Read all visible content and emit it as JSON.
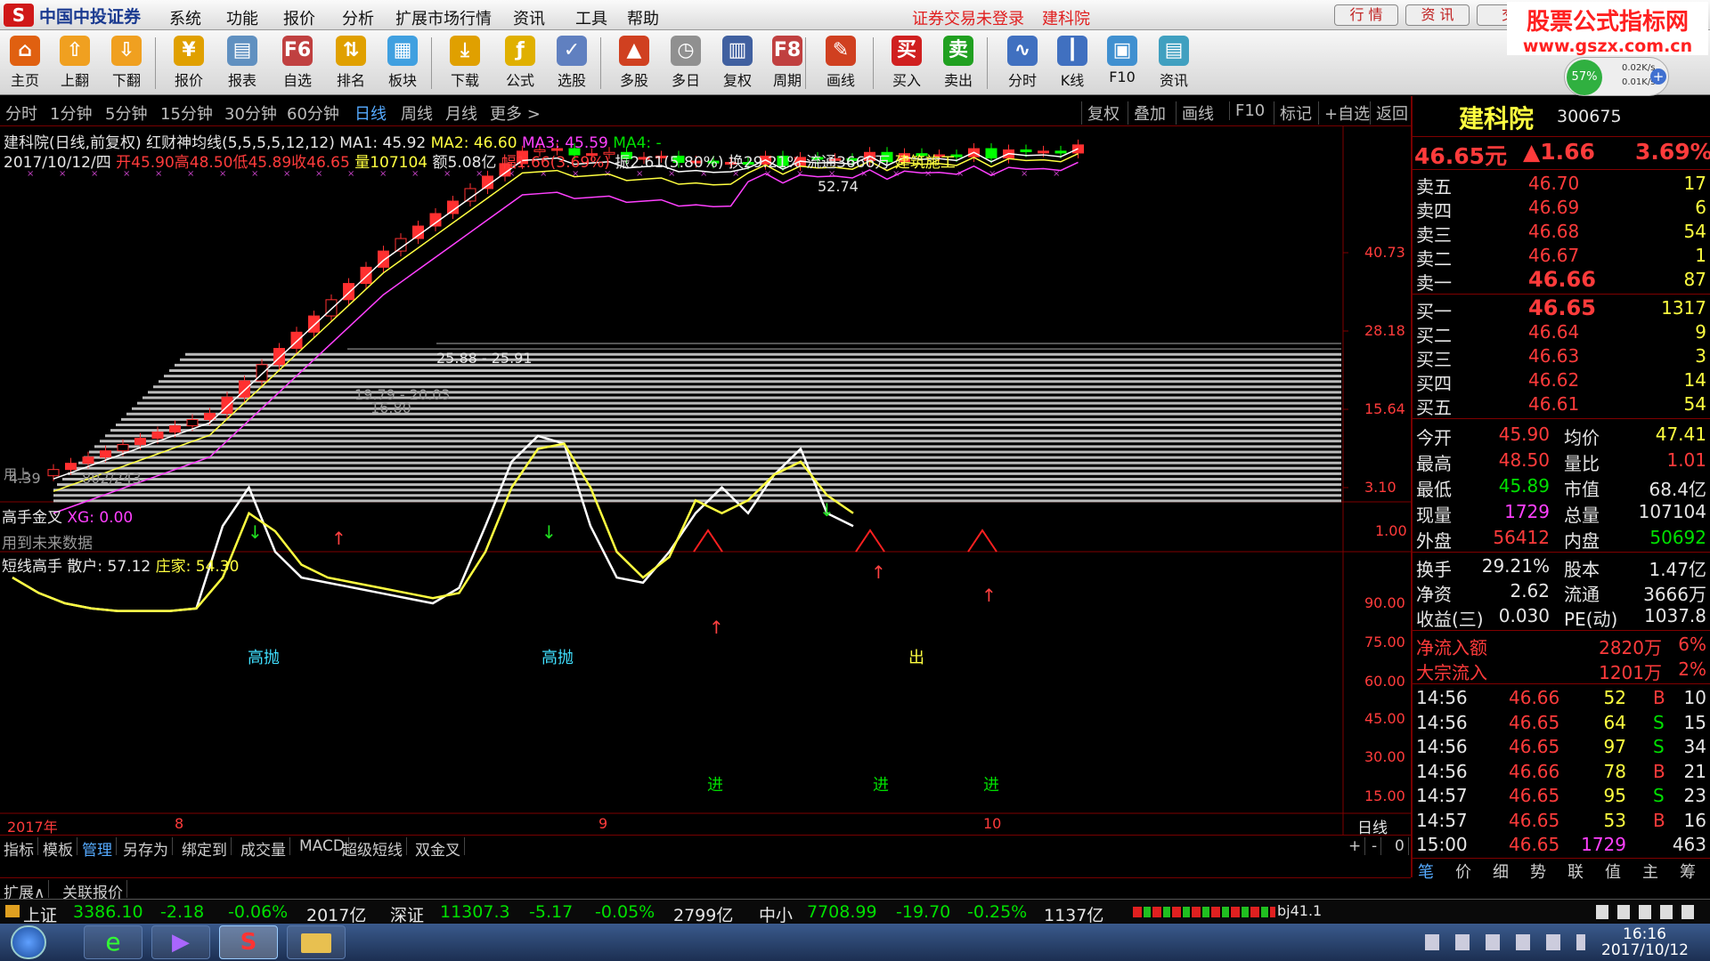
{
  "menu": {
    "app_name": "中国中投证券",
    "items": [
      "系统",
      "功能",
      "报价",
      "分析",
      "扩展市场行情",
      "资讯",
      "工具",
      "帮助"
    ],
    "status": "证券交易未登录",
    "stock": "建科院",
    "tabs": [
      "行 情",
      "资 讯",
      "交"
    ]
  },
  "watermark": {
    "title": "股票公式指标网",
    "url": "www.gszx.com.cn"
  },
  "net": {
    "pct": "57%",
    "up": "0.02K/s",
    "down": "0.01K/s"
  },
  "toolbar": [
    {
      "label": "主页",
      "icon": "home-icon",
      "color": "#e06010"
    },
    {
      "label": "上翻",
      "icon": "up-arrow-icon",
      "color": "#f0a020"
    },
    {
      "label": "下翻",
      "icon": "down-arrow-icon",
      "color": "#f0a020"
    },
    {
      "label": "报价",
      "icon": "yen-icon",
      "color": "#e0a000"
    },
    {
      "label": "报表",
      "icon": "report-icon",
      "color": "#6090c0"
    },
    {
      "label": "自选",
      "icon": "f6-icon",
      "color": "#c04040"
    },
    {
      "label": "排名",
      "icon": "rank-icon",
      "color": "#e0a000"
    },
    {
      "label": "板块",
      "icon": "blocks-icon",
      "color": "#40a0e0"
    },
    {
      "label": "下载",
      "icon": "download-icon",
      "color": "#e0a000"
    },
    {
      "label": "公式",
      "icon": "formula-icon",
      "color": "#e0b000"
    },
    {
      "label": "选股",
      "icon": "pick-stock-icon",
      "color": "#6080c0"
    },
    {
      "label": "多股",
      "icon": "multi-stock-icon",
      "color": "#d04020"
    },
    {
      "label": "多日",
      "icon": "clock-icon",
      "color": "#909090"
    },
    {
      "label": "复权",
      "icon": "restore-right-icon",
      "color": "#4060a0"
    },
    {
      "label": "周期",
      "icon": "f8-icon",
      "color": "#c04040"
    },
    {
      "label": "画线",
      "icon": "pencil-icon",
      "color": "#d04020"
    },
    {
      "label": "买入",
      "icon": "buy-icon",
      "color": "#d02020"
    },
    {
      "label": "卖出",
      "icon": "sell-icon",
      "color": "#20a020"
    },
    {
      "label": "分时",
      "icon": "intraday-icon",
      "color": "#4070c0"
    },
    {
      "label": "K线",
      "icon": "kline-icon",
      "color": "#4070c0"
    },
    {
      "label": "F10",
      "icon": "f10-icon",
      "color": "#4090d0"
    },
    {
      "label": "资讯",
      "icon": "news-icon",
      "color": "#40a0c0"
    }
  ],
  "periods": [
    "分时",
    "1分钟",
    "5分钟",
    "15分钟",
    "30分钟",
    "60分钟",
    "日线",
    "周线",
    "月线",
    "更多 >"
  ],
  "period_selected": "日线",
  "chart_tools": [
    "复权",
    "叠加",
    "画线",
    "F10",
    "标记",
    "+自选",
    "返回"
  ],
  "kline": {
    "info1_name": "建科院(日线,前复权) 红财神均线(5,5,5,5,12,12)",
    "ma1": "MA1: 45.92",
    "ma2": "MA2: 46.60",
    "ma3": "MA3: 45.59",
    "ma4": "MA4: -",
    "info2_date": "2017/10/12/四",
    "info2_open": "开45.90",
    "info2_high": "高48.50",
    "info2_low": "低45.89",
    "info2_close": "收46.65",
    "info2_vol": "量107104",
    "info2_amt": "额5.08亿",
    "info2_chg": "幅1.66(3.69%)",
    "info2_amp": "振2.61(5.80%) 换29.21% 流通3666万",
    "info2_ind": "建筑施工",
    "yticks": [
      "40.73",
      "28.18",
      "15.64",
      "3.10"
    ],
    "high_label": "52.74",
    "line_label1": "25.88 - 25.91",
    "line_label2": "19.79 - 20.03",
    "line_label3": "16.80",
    "low_label": "4.39",
    "low_label2": "802/243",
    "low_bottom_label": "用上"
  },
  "gold": {
    "title": "高手金叉",
    "xg": "XG: 0.00",
    "note": "用到未来数据",
    "ytick": "1.00"
  },
  "osc": {
    "title": "短线高手",
    "retail": "散户: 57.12",
    "dealer": "庄家: 54.30",
    "yticks": [
      "90.00",
      "75.00",
      "60.00",
      "45.00",
      "30.00",
      "15.00"
    ],
    "labels": [
      "高抛",
      "高抛",
      "出",
      "进",
      "进",
      "进"
    ]
  },
  "xaxis": {
    "year": "2017年",
    "m8": "8",
    "m9": "9",
    "m10": "10",
    "period": "日线"
  },
  "bottom_tabs": [
    "指标",
    "模板",
    "管理",
    "另存为",
    "绑定到",
    "成交量",
    "MACD",
    "超级短线",
    "双金叉"
  ],
  "bottom_right": [
    "+",
    "-",
    "0"
  ],
  "bottom_tabs2": [
    "扩展∧",
    "关联报价"
  ],
  "quote": {
    "name": "建科院",
    "code": "300675",
    "price": "46.65元",
    "change": "▲1.66",
    "pct": "3.69%",
    "asks": [
      {
        "l": "卖五",
        "p": "46.70",
        "v": "17"
      },
      {
        "l": "卖四",
        "p": "46.69",
        "v": "6"
      },
      {
        "l": "卖三",
        "p": "46.68",
        "v": "54"
      },
      {
        "l": "卖二",
        "p": "46.67",
        "v": "1"
      },
      {
        "l": "卖一",
        "p": "46.66",
        "v": "87"
      }
    ],
    "bids": [
      {
        "l": "买一",
        "p": "46.65",
        "v": "1317"
      },
      {
        "l": "买二",
        "p": "46.64",
        "v": "9"
      },
      {
        "l": "买三",
        "p": "46.63",
        "v": "3"
      },
      {
        "l": "买四",
        "p": "46.62",
        "v": "14"
      },
      {
        "l": "买五",
        "p": "46.61",
        "v": "54"
      }
    ],
    "stats1": [
      {
        "a": "今开",
        "av": "45.90",
        "b": "均价",
        "bv": "47.41"
      },
      {
        "a": "最高",
        "av": "48.50",
        "b": "量比",
        "bv": "1.01"
      },
      {
        "a": "最低",
        "av": "45.89",
        "b": "市值",
        "bv": "68.4亿"
      },
      {
        "a": "现量",
        "av": "1729",
        "b": "总量",
        "bv": "107104"
      },
      {
        "a": "外盘",
        "av": "56412",
        "b": "内盘",
        "bv": "50692"
      }
    ],
    "stats2": [
      {
        "a": "换手",
        "av": "29.21%",
        "b": "股本",
        "bv": "1.47亿"
      },
      {
        "a": "净资",
        "av": "2.62",
        "b": "流通",
        "bv": "3666万"
      },
      {
        "a": "收益(三)",
        "av": "0.030",
        "b": "PE(动)",
        "bv": "1037.8"
      }
    ],
    "flows": [
      {
        "a": "净流入额",
        "v": "2820万",
        "p": "6%"
      },
      {
        "a": "大宗流入",
        "v": "1201万",
        "p": "2%"
      }
    ],
    "ticks": [
      {
        "t": "14:56",
        "p": "46.66",
        "v": "52",
        "d": "B",
        "n": "10"
      },
      {
        "t": "14:56",
        "p": "46.65",
        "v": "64",
        "d": "S",
        "n": "15"
      },
      {
        "t": "14:56",
        "p": "46.65",
        "v": "97",
        "d": "S",
        "n": "34"
      },
      {
        "t": "14:56",
        "p": "46.66",
        "v": "78",
        "d": "B",
        "n": "21"
      },
      {
        "t": "14:57",
        "p": "46.65",
        "v": "95",
        "d": "S",
        "n": "23"
      },
      {
        "t": "14:57",
        "p": "46.65",
        "v": "53",
        "d": "B",
        "n": "16"
      },
      {
        "t": "15:00",
        "p": "46.65",
        "v": "1729",
        "d": "",
        "n": "463"
      }
    ],
    "tabs": [
      "笔",
      "价",
      "细",
      "势",
      "联",
      "值",
      "主",
      "筹"
    ]
  },
  "status": {
    "sh_name": "上证",
    "sh_val": "3386.10",
    "sh_chg": "-2.18",
    "sh_pct": "-0.06%",
    "sh_amt": "2017亿",
    "sz_name": "深证",
    "sz_val": "11307.3",
    "sz_chg": "-5.17",
    "sz_pct": "-0.05%",
    "sz_amt": "2799亿",
    "zx_name": "中小",
    "zx_val": "7708.99",
    "zx_chg": "-19.70",
    "zx_pct": "-0.25%",
    "zx_amt": "1137亿",
    "server": "bj41.1"
  },
  "taskbar": {
    "time": "16:16",
    "date": "2017/10/12"
  }
}
